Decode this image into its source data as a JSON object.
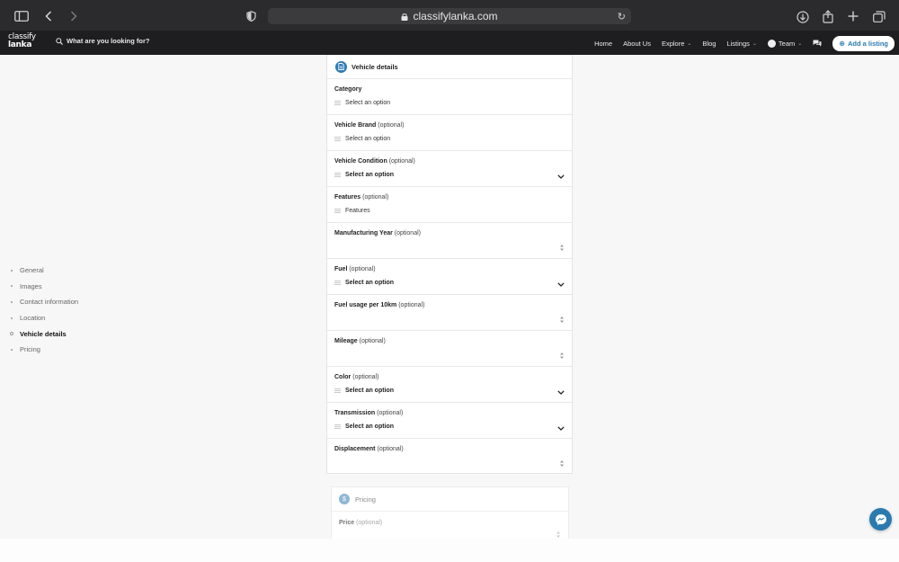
{
  "browser": {
    "url": "classifylanka.com"
  },
  "header": {
    "logo_line1": "classify",
    "logo_line2": "lanka",
    "search_placeholder": "What are you looking for?",
    "nav": {
      "home": "Home",
      "about": "About Us",
      "explore": "Explore",
      "blog": "Blog",
      "listings": "Listings",
      "team": "Team"
    },
    "add_listing": "Add a listing"
  },
  "sidebar": {
    "items": [
      "General",
      "Images",
      "Contact information",
      "Location",
      "Vehicle details",
      "Pricing"
    ],
    "active": "Vehicle details"
  },
  "vehicle_details": {
    "title": "Vehicle details",
    "optional_tag": "(optional)",
    "fields": {
      "category": {
        "label": "Category",
        "value": "Select an option"
      },
      "brand": {
        "label": "Vehicle Brand",
        "value": "Select an option"
      },
      "condition": {
        "label": "Vehicle Condition",
        "value": "Select an option"
      },
      "features": {
        "label": "Features",
        "value": "Features"
      },
      "year": {
        "label": "Manufacturing Year"
      },
      "fuel": {
        "label": "Fuel",
        "value": "Select an option"
      },
      "fuel_usage": {
        "label": "Fuel usage per 10km"
      },
      "mileage": {
        "label": "Mileage"
      },
      "color": {
        "label": "Color",
        "value": "Select an option"
      },
      "transmission": {
        "label": "Transmission",
        "value": "Select an option"
      },
      "displacement": {
        "label": "Displacement"
      }
    }
  },
  "pricing": {
    "icon": "$",
    "title": "Pricing",
    "price_label": "Price",
    "optional_tag": "(optional)"
  },
  "colors": {
    "accent": "#2a7ab0",
    "header_bg": "#1e1e20",
    "browser_bg": "#2b2b2d"
  }
}
